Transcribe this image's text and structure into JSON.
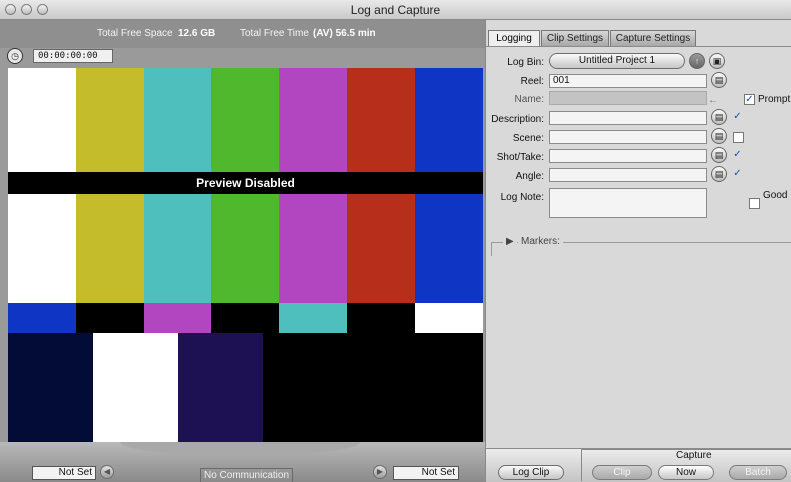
{
  "window": {
    "title": "Log and Capture"
  },
  "viewer": {
    "free_space_label": "Total Free Space",
    "free_space_value": "12.6 GB",
    "free_time_label": "Total Free Time",
    "free_time_value": "(AV) 56.5 min",
    "timecode": "00:00:00:00",
    "preview_text": "Preview Disabled",
    "in_point": "Not Set",
    "out_point": "Not Set",
    "device_status": "No Communication"
  },
  "colors": {
    "white": "#ffffff",
    "yellow": "#c4bc2a",
    "cyan": "#4fbfbe",
    "green": "#50b82c",
    "magenta": "#b246c0",
    "red": "#b72e1a",
    "blue": "#0f35c4",
    "black": "#000000",
    "navy": "#030c36",
    "purple": "#1e1153"
  },
  "panel": {
    "tabs": [
      "Logging",
      "Clip Settings",
      "Capture Settings"
    ],
    "log_bin_label": "Log Bin:",
    "log_bin_value": "Untitled Project 1",
    "reel_label": "Reel:",
    "reel_value": "001",
    "name_label": "Name:",
    "name_value": "",
    "prompt_label": "Prompt",
    "description_label": "Description:",
    "scene_label": "Scene:",
    "shot_take_label": "Shot/Take:",
    "angle_label": "Angle:",
    "log_note_label": "Log Note:",
    "good_label": "Good",
    "markers_label": "Markers:",
    "log_clip_button": "Log Clip",
    "capture_label": "Capture",
    "clip_button": "Clip",
    "now_button": "Now",
    "batch_button": "Batch"
  }
}
